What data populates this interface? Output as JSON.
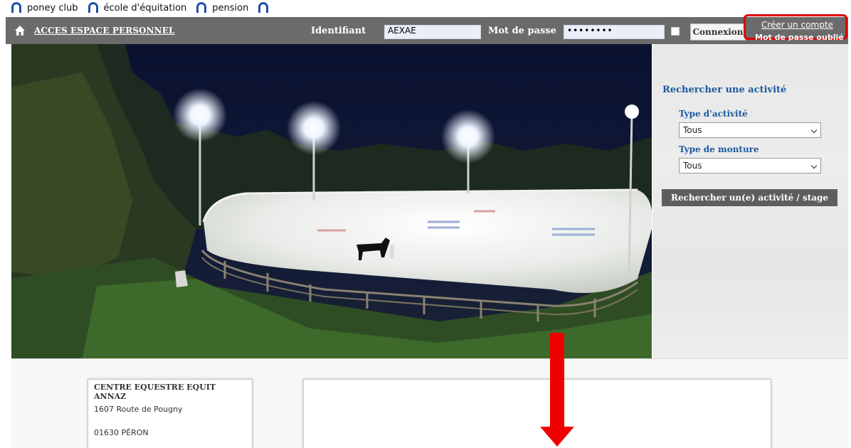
{
  "brand": {
    "items": [
      {
        "label": "poney club",
        "icon": "horseshoe-icon"
      },
      {
        "label": "école d'équitation",
        "icon": "horseshoe-icon"
      },
      {
        "label": "pension",
        "icon": "horseshoe-icon"
      }
    ],
    "icon_color": "#1f4fa8"
  },
  "header": {
    "home_icon": "home-icon",
    "acces_label": "ACCES ESPACE PERSONNEL",
    "identifiant_label": "Identifiant",
    "identifiant_value": "AEXAE",
    "password_label": "Mot de passe",
    "password_value": "••••••••",
    "connexion_label": "Connexion",
    "creer_compte_label": "Créer un compte",
    "mot_de_passe_oublie_label": "Mot de passe oublié",
    "bg_color": "#6b6b6b"
  },
  "search": {
    "title": "Rechercher une activité",
    "type_activite_label": "Type d'activité",
    "type_activite_value": "Tous",
    "type_monture_label": "Type de monture",
    "type_monture_value": "Tous",
    "button_label": "Rechercher un(e) activité / stage",
    "title_color": "#1a5a9e"
  },
  "address": {
    "name": "CENTRE EQUESTRE EQUIT ANNAZ",
    "street": "1607 Route de Pougny",
    "city": "01630 PÉRON"
  },
  "annotation": {
    "highlight_color": "#e00000",
    "arrow_color": "#ee0000"
  }
}
